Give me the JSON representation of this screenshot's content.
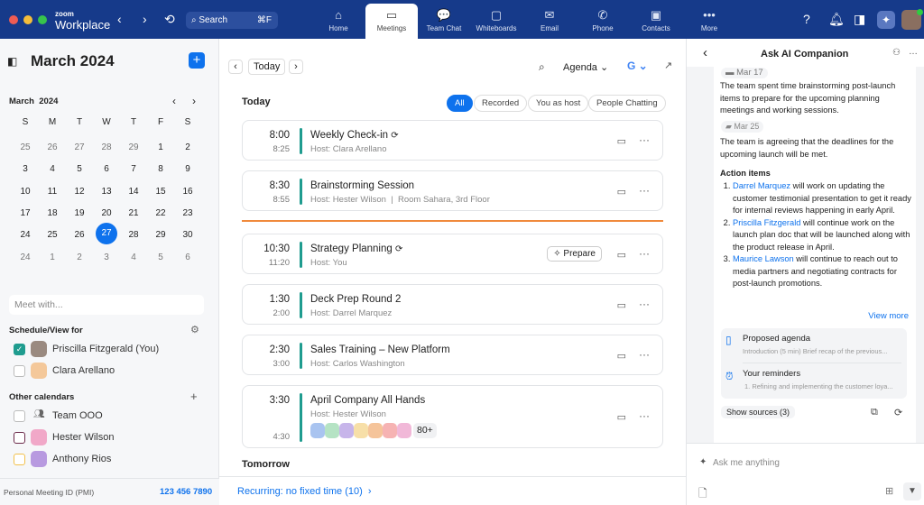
{
  "topbar": {
    "brand_small": "zoom",
    "brand": "Workplace",
    "search_placeholder": "Search",
    "search_shortcut": "⌘F",
    "tabs": [
      {
        "label": "Home",
        "icon": "⌂"
      },
      {
        "label": "Meetings",
        "icon": "▭"
      },
      {
        "label": "Team Chat",
        "icon": "💬"
      },
      {
        "label": "Whiteboards",
        "icon": "▢"
      },
      {
        "label": "Email",
        "icon": "✉"
      },
      {
        "label": "Phone",
        "icon": "✆"
      },
      {
        "label": "Contacts",
        "icon": "▣"
      },
      {
        "label": "More",
        "icon": "•••"
      }
    ]
  },
  "sidebar": {
    "title": "March 2024",
    "mini_month": "March",
    "mini_year": "2024",
    "weekdays": [
      "S",
      "M",
      "T",
      "W",
      "T",
      "F",
      "S"
    ],
    "weeks": [
      [
        "25",
        "26",
        "27",
        "28",
        "29",
        "1",
        "2"
      ],
      [
        "3",
        "4",
        "5",
        "6",
        "7",
        "8",
        "9"
      ],
      [
        "10",
        "11",
        "12",
        "13",
        "14",
        "15",
        "16"
      ],
      [
        "17",
        "18",
        "19",
        "20",
        "21",
        "22",
        "23"
      ],
      [
        "24",
        "25",
        "26",
        "27",
        "28",
        "29",
        "30"
      ],
      [
        "24",
        "1",
        "2",
        "3",
        "4",
        "5",
        "6"
      ]
    ],
    "meet_placeholder": "Meet with...",
    "schedule_header": "Schedule/View for",
    "schedule_people": [
      "Priscilla Fitzgerald (You)",
      "Clara Arellano"
    ],
    "other_header": "Other calendars",
    "other_calendars": [
      "Team OOO",
      "Hester Wilson",
      "Anthony Rios"
    ],
    "pmi_label": "Personal Meeting ID (PMI)",
    "pmi_value": "123 456 7890"
  },
  "main": {
    "today_button": "Today",
    "view_select": "Agenda",
    "section_today": "Today",
    "section_tomorrow": "Tomorrow",
    "filters": [
      "All",
      "Recorded",
      "You as host",
      "People Chatting"
    ],
    "meetings": [
      {
        "start": "8:00",
        "end": "8:25",
        "title": "Weekly Check-in",
        "host": "Host: Clara Arellano"
      },
      {
        "start": "8:30",
        "end": "8:55",
        "title": "Brainstorming Session",
        "host": "Host: Hester Wilson",
        "room": "Room Sahara, 3rd Floor"
      },
      {
        "start": "10:30",
        "end": "11:20",
        "title": "Strategy Planning",
        "host": "Host: You",
        "action": "Prepare"
      },
      {
        "start": "1:30",
        "end": "2:00",
        "title": "Deck Prep Round 2",
        "host": "Host: Darrel Marquez"
      },
      {
        "start": "2:30",
        "end": "3:00",
        "title": "Sales Training – New Platform",
        "host": "Host: Carlos Washington"
      },
      {
        "start": "3:30",
        "end": "4:30",
        "title": "April Company All Hands",
        "host": "Host: Hester Wilson",
        "attendee_extra": "80+"
      }
    ],
    "recurring": "Recurring: no fixed time (10)"
  },
  "ai": {
    "title": "Ask AI Companion",
    "date1": "Mar 17",
    "para1": "The team spent time brainstorming post-launch items to prepare for the upcoming planning meetings and working sessions.",
    "date2": "Mar 25",
    "para2": "The team is agreeing that the deadlines for the upcoming launch will be met.",
    "action_header": "Action items",
    "actions": [
      {
        "name": "Darrel Marquez",
        "text": " will work on updating the customer testimonial presentation to get it ready for internal reviews happening in early April."
      },
      {
        "name": "Priscilla Fitzgerald",
        "text": " will continue work on the launch plan doc that will be launched along with the product release in April."
      },
      {
        "name": "Maurice Lawson",
        "text": " will continue to reach out to media partners and negotiating contracts for post-launch promotions."
      }
    ],
    "view_more": "View more",
    "sources": [
      {
        "title": "Proposed agenda",
        "snippet": "Introduction (5 min) Brief recap of the previous..."
      },
      {
        "title": "Your reminders",
        "snippet": "1. Refining and implementing the customer loya..."
      }
    ],
    "show_sources": "Show sources (3)",
    "input_placeholder": "Ask me anything"
  }
}
